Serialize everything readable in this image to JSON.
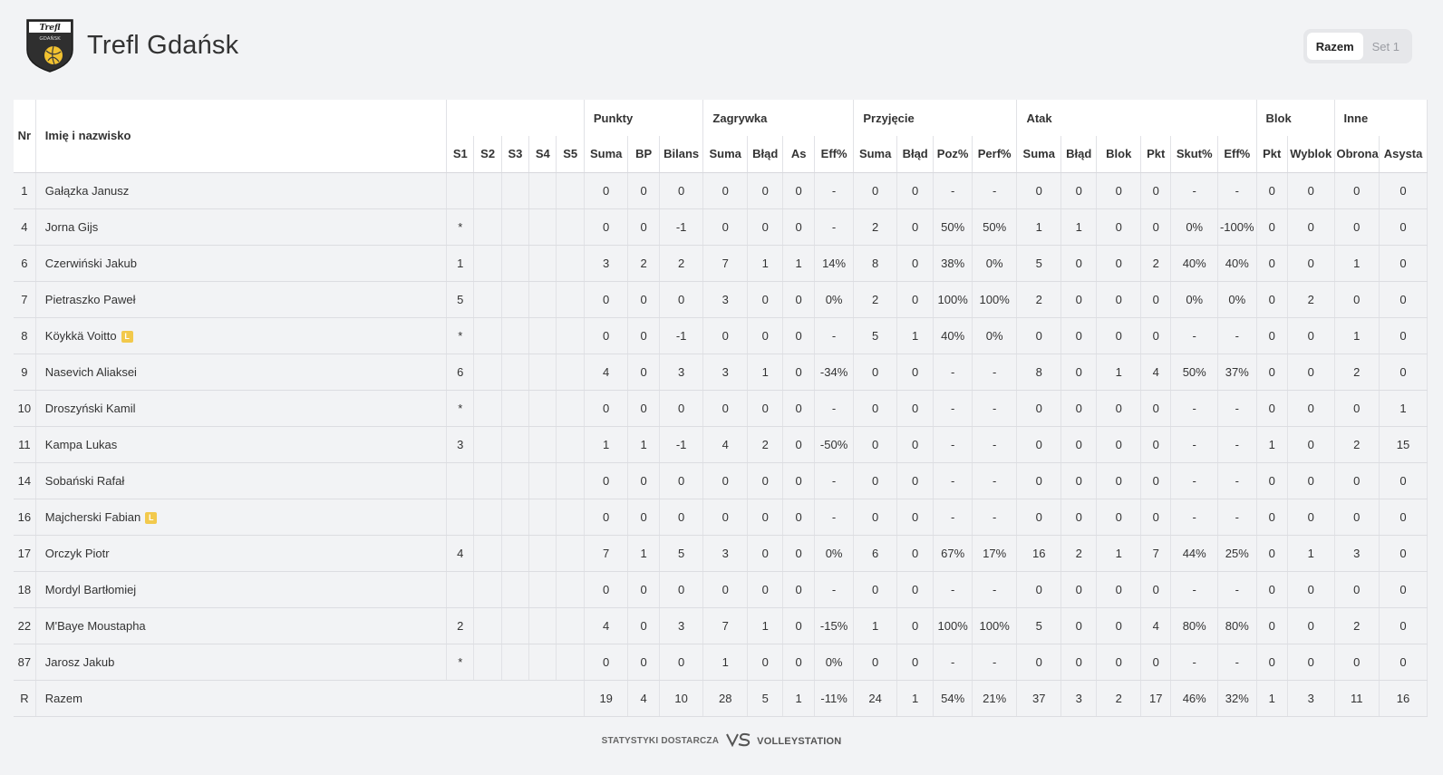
{
  "team": {
    "name": "Trefl Gdańsk",
    "logo_text_top": "Trefl",
    "logo_text_mid": "GDAŃSK"
  },
  "toggle": {
    "options": [
      "Razem",
      "Set 1"
    ],
    "active": "Razem"
  },
  "table": {
    "col_nr": "Nr",
    "col_name": "Imię i nazwisko",
    "groups": {
      "punkty": "Punkty",
      "zagrywka": "Zagrywka",
      "przyjecie": "Przyjęcie",
      "atak": "Atak",
      "blok": "Blok",
      "inne": "Inne"
    },
    "subheaders": [
      "S1",
      "S2",
      "S3",
      "S4",
      "S5",
      "Suma",
      "BP",
      "Bilans",
      "Suma",
      "Błąd",
      "As",
      "Eff%",
      "Suma",
      "Błąd",
      "Poz%",
      "Perf%",
      "Suma",
      "Błąd",
      "Blok",
      "Pkt",
      "Skut%",
      "Eff%",
      "Pkt",
      "Wyblok",
      "Obrona",
      "Asysta"
    ],
    "rows": [
      {
        "nr": "1",
        "name": "Gałązka Janusz",
        "libero": false,
        "sets": [
          "",
          "",
          "",
          "",
          ""
        ],
        "stats": [
          "0",
          "0",
          "0",
          "0",
          "0",
          "0",
          "-",
          "0",
          "0",
          "-",
          "-",
          "0",
          "0",
          "0",
          "0",
          "-",
          "-",
          "0",
          "0",
          "0",
          "0"
        ]
      },
      {
        "nr": "4",
        "name": "Jorna Gijs",
        "libero": false,
        "sets": [
          "*",
          "",
          "",
          "",
          ""
        ],
        "stats": [
          "0",
          "0",
          "-1",
          "0",
          "0",
          "0",
          "-",
          "2",
          "0",
          "50%",
          "50%",
          "1",
          "1",
          "0",
          "0",
          "0%",
          "-100%",
          "0",
          "0",
          "0",
          "0"
        ]
      },
      {
        "nr": "6",
        "name": "Czerwiński Jakub",
        "libero": false,
        "sets": [
          "1",
          "",
          "",
          "",
          ""
        ],
        "stats": [
          "3",
          "2",
          "2",
          "7",
          "1",
          "1",
          "14%",
          "8",
          "0",
          "38%",
          "0%",
          "5",
          "0",
          "0",
          "2",
          "40%",
          "40%",
          "0",
          "0",
          "1",
          "0"
        ]
      },
      {
        "nr": "7",
        "name": "Pietraszko Paweł",
        "libero": false,
        "sets": [
          "5",
          "",
          "",
          "",
          ""
        ],
        "stats": [
          "0",
          "0",
          "0",
          "3",
          "0",
          "0",
          "0%",
          "2",
          "0",
          "100%",
          "100%",
          "2",
          "0",
          "0",
          "0",
          "0%",
          "0%",
          "0",
          "2",
          "0",
          "0"
        ]
      },
      {
        "nr": "8",
        "name": "Köykkä Voitto",
        "libero": true,
        "sets": [
          "*",
          "",
          "",
          "",
          ""
        ],
        "stats": [
          "0",
          "0",
          "-1",
          "0",
          "0",
          "0",
          "-",
          "5",
          "1",
          "40%",
          "0%",
          "0",
          "0",
          "0",
          "0",
          "-",
          "-",
          "0",
          "0",
          "1",
          "0"
        ]
      },
      {
        "nr": "9",
        "name": "Nasevich Aliaksei",
        "libero": false,
        "sets": [
          "6",
          "",
          "",
          "",
          ""
        ],
        "stats": [
          "4",
          "0",
          "3",
          "3",
          "1",
          "0",
          "-34%",
          "0",
          "0",
          "-",
          "-",
          "8",
          "0",
          "1",
          "4",
          "50%",
          "37%",
          "0",
          "0",
          "2",
          "0"
        ]
      },
      {
        "nr": "10",
        "name": "Droszyński Kamil",
        "libero": false,
        "sets": [
          "*",
          "",
          "",
          "",
          ""
        ],
        "stats": [
          "0",
          "0",
          "0",
          "0",
          "0",
          "0",
          "-",
          "0",
          "0",
          "-",
          "-",
          "0",
          "0",
          "0",
          "0",
          "-",
          "-",
          "0",
          "0",
          "0",
          "1"
        ]
      },
      {
        "nr": "11",
        "name": "Kampa Lukas",
        "libero": false,
        "sets": [
          "3",
          "",
          "",
          "",
          ""
        ],
        "stats": [
          "1",
          "1",
          "-1",
          "4",
          "2",
          "0",
          "-50%",
          "0",
          "0",
          "-",
          "-",
          "0",
          "0",
          "0",
          "0",
          "-",
          "-",
          "1",
          "0",
          "2",
          "15"
        ]
      },
      {
        "nr": "14",
        "name": "Sobański Rafał",
        "libero": false,
        "sets": [
          "",
          "",
          "",
          "",
          ""
        ],
        "stats": [
          "0",
          "0",
          "0",
          "0",
          "0",
          "0",
          "-",
          "0",
          "0",
          "-",
          "-",
          "0",
          "0",
          "0",
          "0",
          "-",
          "-",
          "0",
          "0",
          "0",
          "0"
        ]
      },
      {
        "nr": "16",
        "name": "Majcherski Fabian",
        "libero": true,
        "sets": [
          "",
          "",
          "",
          "",
          ""
        ],
        "stats": [
          "0",
          "0",
          "0",
          "0",
          "0",
          "0",
          "-",
          "0",
          "0",
          "-",
          "-",
          "0",
          "0",
          "0",
          "0",
          "-",
          "-",
          "0",
          "0",
          "0",
          "0"
        ]
      },
      {
        "nr": "17",
        "name": "Orczyk Piotr",
        "libero": false,
        "sets": [
          "4",
          "",
          "",
          "",
          ""
        ],
        "stats": [
          "7",
          "1",
          "5",
          "3",
          "0",
          "0",
          "0%",
          "6",
          "0",
          "67%",
          "17%",
          "16",
          "2",
          "1",
          "7",
          "44%",
          "25%",
          "0",
          "1",
          "3",
          "0"
        ]
      },
      {
        "nr": "18",
        "name": "Mordyl Bartłomiej",
        "libero": false,
        "sets": [
          "",
          "",
          "",
          "",
          ""
        ],
        "stats": [
          "0",
          "0",
          "0",
          "0",
          "0",
          "0",
          "-",
          "0",
          "0",
          "-",
          "-",
          "0",
          "0",
          "0",
          "0",
          "-",
          "-",
          "0",
          "0",
          "0",
          "0"
        ]
      },
      {
        "nr": "22",
        "name": "M'Baye Moustapha",
        "libero": false,
        "sets": [
          "2",
          "",
          "",
          "",
          ""
        ],
        "stats": [
          "4",
          "0",
          "3",
          "7",
          "1",
          "0",
          "-15%",
          "1",
          "0",
          "100%",
          "100%",
          "5",
          "0",
          "0",
          "4",
          "80%",
          "80%",
          "0",
          "0",
          "2",
          "0"
        ]
      },
      {
        "nr": "87",
        "name": "Jarosz Jakub",
        "libero": false,
        "sets": [
          "*",
          "",
          "",
          "",
          ""
        ],
        "stats": [
          "0",
          "0",
          "0",
          "1",
          "0",
          "0",
          "0%",
          "0",
          "0",
          "-",
          "-",
          "0",
          "0",
          "0",
          "0",
          "-",
          "-",
          "0",
          "0",
          "0",
          "0"
        ]
      }
    ],
    "total": {
      "nr": "R",
      "name": "Razem",
      "stats": [
        "19",
        "4",
        "10",
        "28",
        "5",
        "1",
        "-11%",
        "24",
        "1",
        "54%",
        "21%",
        "37",
        "3",
        "2",
        "17",
        "46%",
        "32%",
        "1",
        "3",
        "11",
        "16"
      ]
    },
    "libero_badge": "L"
  },
  "footer": {
    "provider_text": "STATYSTYKI DOSTARCZA",
    "brand": "VOLLEYSTATION"
  },
  "colors": {
    "background": "#f2f3f5",
    "libero_badge": "#f2c94c",
    "logo_yellow": "#f2c230"
  }
}
